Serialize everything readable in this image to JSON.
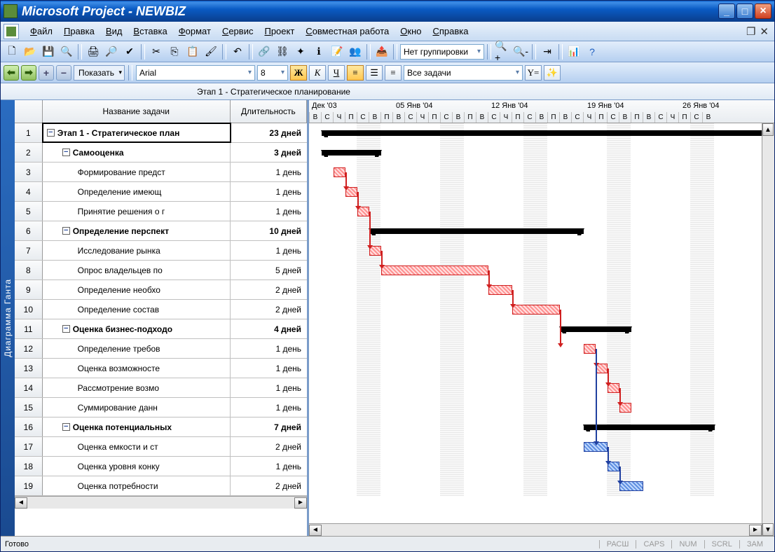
{
  "title": "Microsoft Project - NEWBIZ",
  "menu": {
    "items": [
      "Файл",
      "Правка",
      "Вид",
      "Вставка",
      "Формат",
      "Сервис",
      "Проект",
      "Совместная работа",
      "Окно",
      "Справка"
    ]
  },
  "toolbar1": {
    "group_dropdown": "Нет группировки"
  },
  "toolbar2": {
    "show": "Показать",
    "font": "Arial",
    "size": "8",
    "filter": "Все задачи",
    "yfilter": "Y="
  },
  "entry": "Этап 1 - Стратегическое планирование",
  "side": "Диаграмма Ганта",
  "columns": {
    "name": "Название задачи",
    "duration": "Длительность"
  },
  "tasks": [
    {
      "id": 1,
      "lvl": 0,
      "expand": true,
      "bold": true,
      "name": "Этап 1 - Стратегическое план",
      "dur": "23 дней",
      "type": "summary",
      "start": 0,
      "len": 38
    },
    {
      "id": 2,
      "lvl": 1,
      "expand": true,
      "bold": true,
      "name": "Самооценка",
      "dur": "3 дней",
      "type": "summary",
      "start": 0,
      "len": 5
    },
    {
      "id": 3,
      "lvl": 2,
      "name": "Формирование предст",
      "dur": "1 день",
      "type": "red",
      "start": 1,
      "len": 1
    },
    {
      "id": 4,
      "lvl": 2,
      "name": "Определение имеющ",
      "dur": "1 день",
      "type": "red",
      "start": 2,
      "len": 1
    },
    {
      "id": 5,
      "lvl": 2,
      "name": "Принятие решения о г",
      "dur": "1 день",
      "type": "red",
      "start": 3,
      "len": 1
    },
    {
      "id": 6,
      "lvl": 1,
      "expand": true,
      "bold": true,
      "name": "Определение перспект",
      "dur": "10 дней",
      "type": "summary",
      "start": 4,
      "len": 18
    },
    {
      "id": 7,
      "lvl": 2,
      "name": "Исследование рынка",
      "dur": "1 день",
      "type": "red",
      "start": 4,
      "len": 1
    },
    {
      "id": 8,
      "lvl": 2,
      "name": "Опрос владельцев по",
      "dur": "5 дней",
      "type": "red",
      "start": 5,
      "len": 9
    },
    {
      "id": 9,
      "lvl": 2,
      "name": "Определение необхо",
      "dur": "2 дней",
      "type": "red",
      "start": 14,
      "len": 2
    },
    {
      "id": 10,
      "lvl": 2,
      "name": "Определение состав",
      "dur": "2 дней",
      "type": "red",
      "start": 16,
      "len": 4
    },
    {
      "id": 11,
      "lvl": 1,
      "expand": true,
      "bold": true,
      "name": "Оценка бизнес-подходо",
      "dur": "4 дней",
      "type": "summary",
      "start": 20,
      "len": 6
    },
    {
      "id": 12,
      "lvl": 2,
      "name": "Определение требов",
      "dur": "1 день",
      "type": "red",
      "start": 22,
      "len": 1
    },
    {
      "id": 13,
      "lvl": 2,
      "name": "Оценка возможносте",
      "dur": "1 день",
      "type": "red",
      "start": 23,
      "len": 1
    },
    {
      "id": 14,
      "lvl": 2,
      "name": "Рассмотрение возмо",
      "dur": "1 день",
      "type": "red",
      "start": 24,
      "len": 1
    },
    {
      "id": 15,
      "lvl": 2,
      "name": "Суммирование данн",
      "dur": "1 день",
      "type": "red",
      "start": 25,
      "len": 1
    },
    {
      "id": 16,
      "lvl": 1,
      "expand": true,
      "bold": true,
      "name": "Оценка потенциальных",
      "dur": "7 дней",
      "type": "summary",
      "start": 22,
      "len": 11
    },
    {
      "id": 17,
      "lvl": 2,
      "name": "Оценка емкости и ст",
      "dur": "2 дней",
      "type": "blue",
      "start": 22,
      "len": 2
    },
    {
      "id": 18,
      "lvl": 2,
      "name": "Оценка уровня конку",
      "dur": "1 день",
      "type": "blue",
      "start": 24,
      "len": 1
    },
    {
      "id": 19,
      "lvl": 2,
      "name": "Оценка потребности",
      "dur": "2 дней",
      "type": "blue",
      "start": 25,
      "len": 2
    }
  ],
  "timeline": {
    "start_label": "Дек '03",
    "weeks": [
      "05 Янв '04",
      "12 Янв '04",
      "19 Янв '04",
      "26 Янв '04"
    ],
    "days": [
      "В",
      "С",
      "Ч",
      "П",
      "С",
      "В",
      "П",
      "В",
      "С",
      "Ч",
      "П",
      "С",
      "В",
      "П",
      "В",
      "С",
      "Ч",
      "П",
      "С",
      "В",
      "П",
      "В",
      "С",
      "Ч",
      "П",
      "С",
      "В",
      "П",
      "В",
      "С",
      "Ч",
      "П",
      "С",
      "В"
    ]
  },
  "status": {
    "ready": "Готово",
    "indicators": [
      "РАСШ",
      "CAPS",
      "NUM",
      "SCRL",
      "ЗАМ"
    ]
  }
}
